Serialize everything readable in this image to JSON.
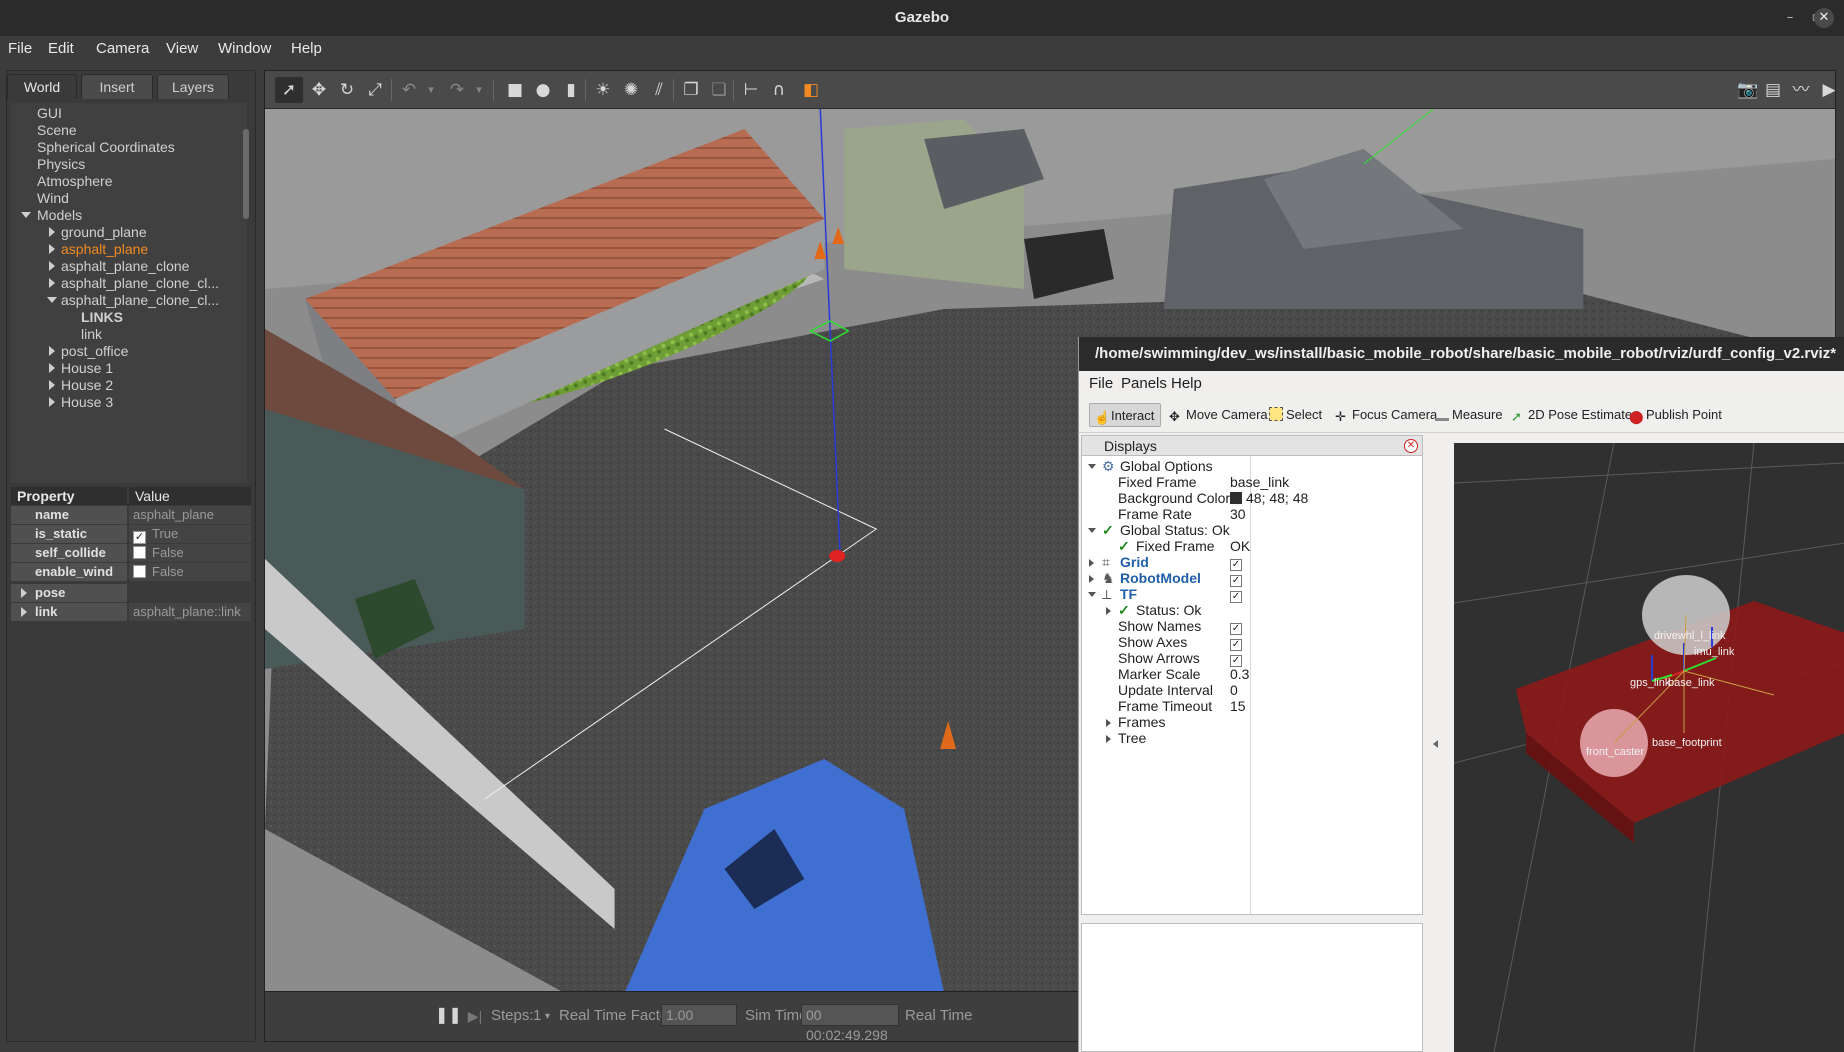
{
  "window": {
    "title": "Gazebo"
  },
  "menu": [
    "File",
    "Edit",
    "Camera",
    "View",
    "Window",
    "Help"
  ],
  "left_tabs": [
    "World",
    "Insert",
    "Layers"
  ],
  "world_tree": {
    "items": [
      "GUI",
      "Scene",
      "Spherical Coordinates",
      "Physics",
      "Atmosphere",
      "Wind"
    ],
    "models_label": "Models",
    "models": [
      "ground_plane",
      "asphalt_plane",
      "asphalt_plane_clone",
      "asphalt_plane_clone_cl...",
      "asphalt_plane_clone_cl..."
    ],
    "links_header": "LINKS",
    "link_item": "link",
    "more_models": [
      "post_office",
      "House 1",
      "House 2",
      "House 3"
    ]
  },
  "properties": {
    "header": {
      "property": "Property",
      "value": "Value"
    },
    "rows": [
      {
        "key": "name",
        "value": "asphalt_plane"
      },
      {
        "key": "is_static",
        "value": "True",
        "checked": true
      },
      {
        "key": "self_collide",
        "value": "False",
        "checked": false
      },
      {
        "key": "enable_wind",
        "value": "False",
        "checked": false
      },
      {
        "key": "pose",
        "value": ""
      },
      {
        "key": "link",
        "value": "asphalt_plane::link"
      }
    ]
  },
  "bottom_bar": {
    "steps_label": "Steps:",
    "steps_value": "1",
    "rtf_label": "Real Time Factor:",
    "rtf_value": "1.00",
    "sim_time_label": "Sim Time:",
    "sim_time_value": "00 00:02:49.298",
    "real_time_label": "Real Time"
  },
  "rviz": {
    "title": "/home/swimming/dev_ws/install/basic_mobile_robot/share/basic_mobile_robot/rviz/urdf_config_v2.rviz*",
    "menu": [
      "File",
      "Panels",
      "Help"
    ],
    "tools": [
      "Interact",
      "Move Camera",
      "Select",
      "Focus Camera",
      "Measure",
      "2D Pose Estimate",
      "Publish Point"
    ],
    "displays_title": "Displays",
    "rows": [
      {
        "key": "Global Options",
        "value": ""
      },
      {
        "key": "Fixed Frame",
        "value": "base_link"
      },
      {
        "key": "Background Color",
        "value": "48; 48; 48"
      },
      {
        "key": "Frame Rate",
        "value": "30"
      },
      {
        "key": "Global Status: Ok",
        "value": ""
      },
      {
        "key": "Fixed Frame",
        "value": "OK"
      },
      {
        "key": "Grid",
        "value": ""
      },
      {
        "key": "RobotModel",
        "value": ""
      },
      {
        "key": "TF",
        "value": ""
      },
      {
        "key": "Status: Ok",
        "value": ""
      },
      {
        "key": "Show Names",
        "value": ""
      },
      {
        "key": "Show Axes",
        "value": ""
      },
      {
        "key": "Show Arrows",
        "value": ""
      },
      {
        "key": "Marker Scale",
        "value": "0.3"
      },
      {
        "key": "Update Interval",
        "value": "0"
      },
      {
        "key": "Frame Timeout",
        "value": "15"
      },
      {
        "key": "Frames",
        "value": ""
      },
      {
        "key": "Tree",
        "value": ""
      }
    ],
    "tf_labels": [
      "drivewhl_l_link",
      "imu_link",
      "gps_link",
      "base_link",
      "front_caster",
      "base_footprint"
    ]
  },
  "colors": {
    "accent": "#f28a21",
    "rviz_bg": "#303030",
    "robot_body": "#8b1a1a"
  }
}
